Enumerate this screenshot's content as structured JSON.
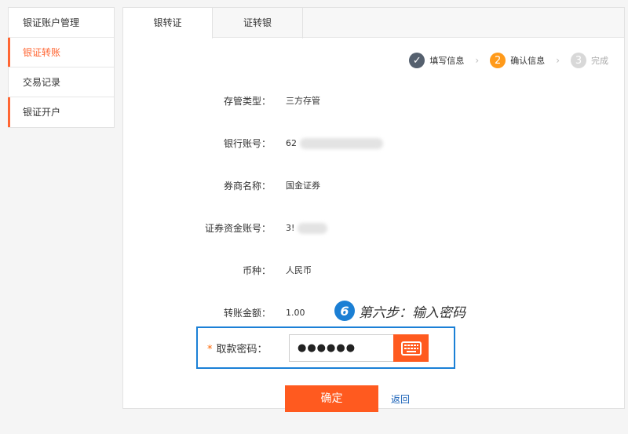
{
  "sidebar": {
    "items": [
      {
        "label": "银证账户管理"
      },
      {
        "label": "银证转账"
      },
      {
        "label": "交易记录"
      },
      {
        "label": "银证开户"
      }
    ]
  },
  "tabs": [
    {
      "label": "银转证"
    },
    {
      "label": "证转银"
    }
  ],
  "steps": [
    {
      "number": "✓",
      "label": "填写信息"
    },
    {
      "number": "2",
      "label": "确认信息"
    },
    {
      "number": "3",
      "label": "完成"
    }
  ],
  "form": {
    "custody_type": {
      "label": "存管类型：",
      "value": "三方存管"
    },
    "bank_account": {
      "label": "银行账号：",
      "value": "62"
    },
    "broker_name": {
      "label": "券商名称：",
      "value": "国金证券"
    },
    "securities_account": {
      "label": "证券资金账号：",
      "value": "3!"
    },
    "currency": {
      "label": "币种：",
      "value": "人民币"
    },
    "amount": {
      "label": "转账金额：",
      "value": "1.00"
    }
  },
  "annotation": {
    "badge": "6",
    "text": "第六步：输入密码"
  },
  "password": {
    "label": "取款密码：",
    "required_mark": "*",
    "value": "●●●●●●"
  },
  "actions": {
    "confirm_label": "确定",
    "back_label": "返回"
  },
  "colors": {
    "accent": "#ff5a1f",
    "annotation_blue": "#1b80d6",
    "link": "#1a62b8"
  }
}
